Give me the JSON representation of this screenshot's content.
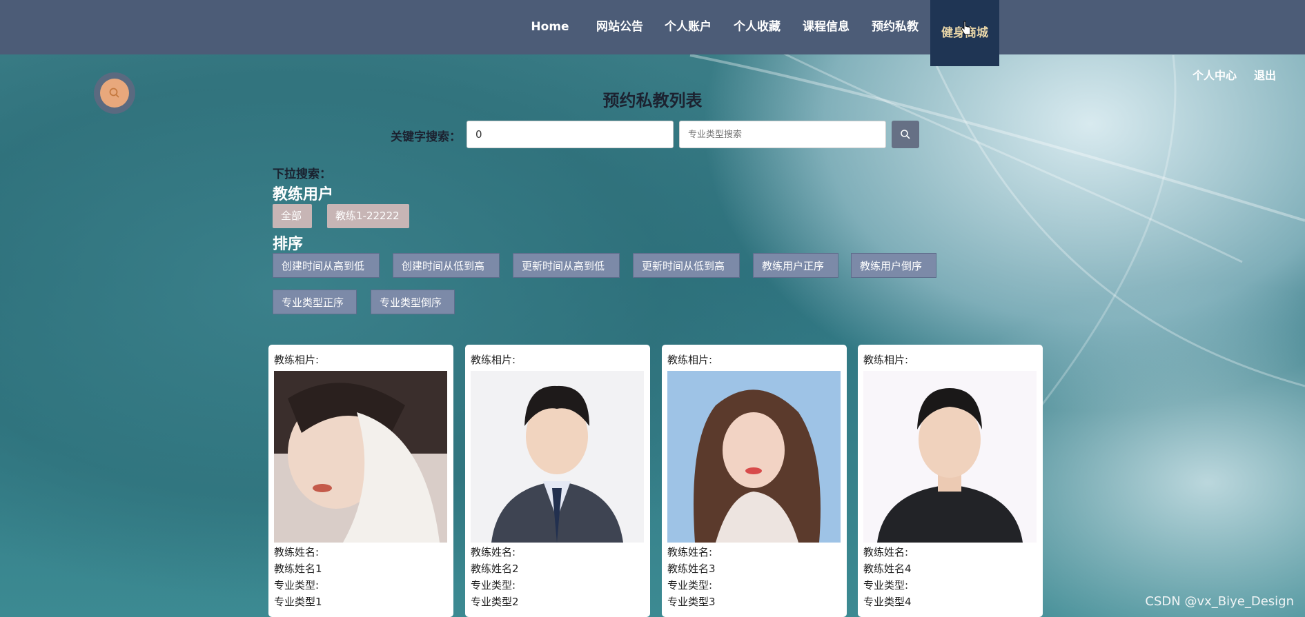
{
  "nav": {
    "items": [
      {
        "label": "Home"
      },
      {
        "label": "网站公告"
      },
      {
        "label": "个人账户"
      },
      {
        "label": "个人收藏"
      },
      {
        "label": "课程信息"
      },
      {
        "label": "预约私教"
      },
      {
        "label": "健身商城"
      }
    ],
    "active_index": 6
  },
  "user_links": {
    "center": "个人中心",
    "logout": "退出"
  },
  "page_title": "预约私教列表",
  "search": {
    "keyword_label": "关键字搜索：",
    "keyword_value": "0",
    "type_placeholder": "专业类型搜索"
  },
  "dropdown_search_label": "下拉搜索：",
  "coach_filter": {
    "title": "教练用户",
    "options": [
      "全部",
      "教练1-22222"
    ]
  },
  "sort": {
    "title": "排序",
    "buttons": [
      "创建时间从高到低",
      "创建时间从低到高",
      "更新时间从高到低",
      "更新时间从低到高",
      "教练用户正序",
      "教练用户倒序",
      "专业类型正序",
      "专业类型倒序"
    ]
  },
  "cards": [
    {
      "photo_label": "教练相片:",
      "name_label": "教练姓名:",
      "name": "教练姓名1",
      "type_label": "专业类型:",
      "type": "专业类型1"
    },
    {
      "photo_label": "教练相片:",
      "name_label": "教练姓名:",
      "name": "教练姓名2",
      "type_label": "专业类型:",
      "type": "专业类型2"
    },
    {
      "photo_label": "教练相片:",
      "name_label": "教练姓名:",
      "name": "教练姓名3",
      "type_label": "专业类型:",
      "type": "专业类型3"
    },
    {
      "photo_label": "教练相片:",
      "name_label": "教练姓名:",
      "name": "教练姓名4",
      "type_label": "专业类型:",
      "type": "专业类型4"
    }
  ],
  "watermark": "CSDN @vx_Biye_Design",
  "colors": {
    "nav_bg": "#4c5c77",
    "nav_active": "#1f3554",
    "sort_btn": "#7c8aa8",
    "pill": "#c7b5b5"
  }
}
